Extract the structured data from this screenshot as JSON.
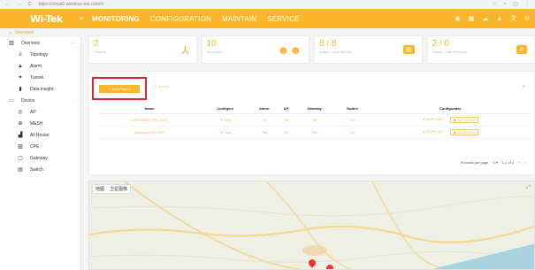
{
  "browser": {
    "url": "https://cloud2.wireless-tek.com/#/",
    "back": "←",
    "forward": "→",
    "reload": "C"
  },
  "brand": {
    "logo": "Wi-Tek",
    "accent": "#fbb62a"
  },
  "nav": {
    "toggle": "≡",
    "items": [
      "MONITORING",
      "CONFIGURATION",
      "MAINTAIN",
      "SERVICE"
    ],
    "active": 0
  },
  "breadcrumb": {
    "text": "Overview"
  },
  "sidebar": {
    "overview": {
      "label": "Overview",
      "icon": "building-icon"
    },
    "overview_items": [
      {
        "label": "Topology",
        "icon": "topology-icon"
      },
      {
        "label": "Alarm",
        "icon": "bell-icon"
      },
      {
        "label": "Tunnel",
        "icon": "tunnel-icon"
      },
      {
        "label": "Data insight",
        "icon": "chart-icon"
      }
    ],
    "device": {
      "label": "Device",
      "icon": "monitor-icon"
    },
    "device_items": [
      {
        "label": "AP",
        "icon": "ap-icon"
      },
      {
        "label": "MESH",
        "icon": "mesh-icon"
      },
      {
        "label": "All Router",
        "icon": "router-icon"
      },
      {
        "label": "CPE",
        "icon": "cpe-icon"
      },
      {
        "label": "Gateway",
        "icon": "gateway-icon"
      },
      {
        "label": "Switch",
        "icon": "switch-icon"
      }
    ]
  },
  "cards": [
    {
      "value": "2",
      "sub": "Projects",
      "icon": "topology-icon",
      "glyph": "⅄"
    },
    {
      "value": "10",
      "sub": "All Alarms",
      "icon": "users-icon",
      "glyph": "👥"
    },
    {
      "value": "8 / 8",
      "sub": "Online / total devices",
      "icon": "router-icon",
      "glyph": "▤"
    },
    {
      "value": "2 / 0",
      "sub": "Online / total terminals",
      "icon": "clipboard-icon",
      "glyph": "✔"
    }
  ],
  "toolbar": {
    "add_label": "Add Project",
    "delete_label": "Delete"
  },
  "table": {
    "headers": [
      "Name",
      "Configure",
      "Alarm",
      "AP",
      "Gateway",
      "Switch",
      "Configurator"
    ],
    "rows": [
      {
        "name": "WIRELESS-TEK 2023",
        "configure": "Edit",
        "alarm": "10",
        "ap": "0/0",
        "gateway": "0/0",
        "switch": "0/0",
        "cfg1": "Wi-Fi 4.5G",
        "cfg2": "NETWORK"
      },
      {
        "name": "Wireless-TEK-SOP",
        "configure": "Edit",
        "alarm": "768",
        "ap": "0/0",
        "gateway": "0/0",
        "switch": "0/0",
        "cfg1": "Wi-Fi 4.5G",
        "cfg2": "NETWORK"
      }
    ]
  },
  "pager": {
    "per_page_label": "Records per page",
    "per_page": "5",
    "range": "1-2 of 2"
  },
  "map": {
    "tab_map": "地图",
    "tab_satellite": "卫星图像",
    "land": "#eef0e6",
    "sea": "#aad3df",
    "road": "#f6d58a"
  }
}
